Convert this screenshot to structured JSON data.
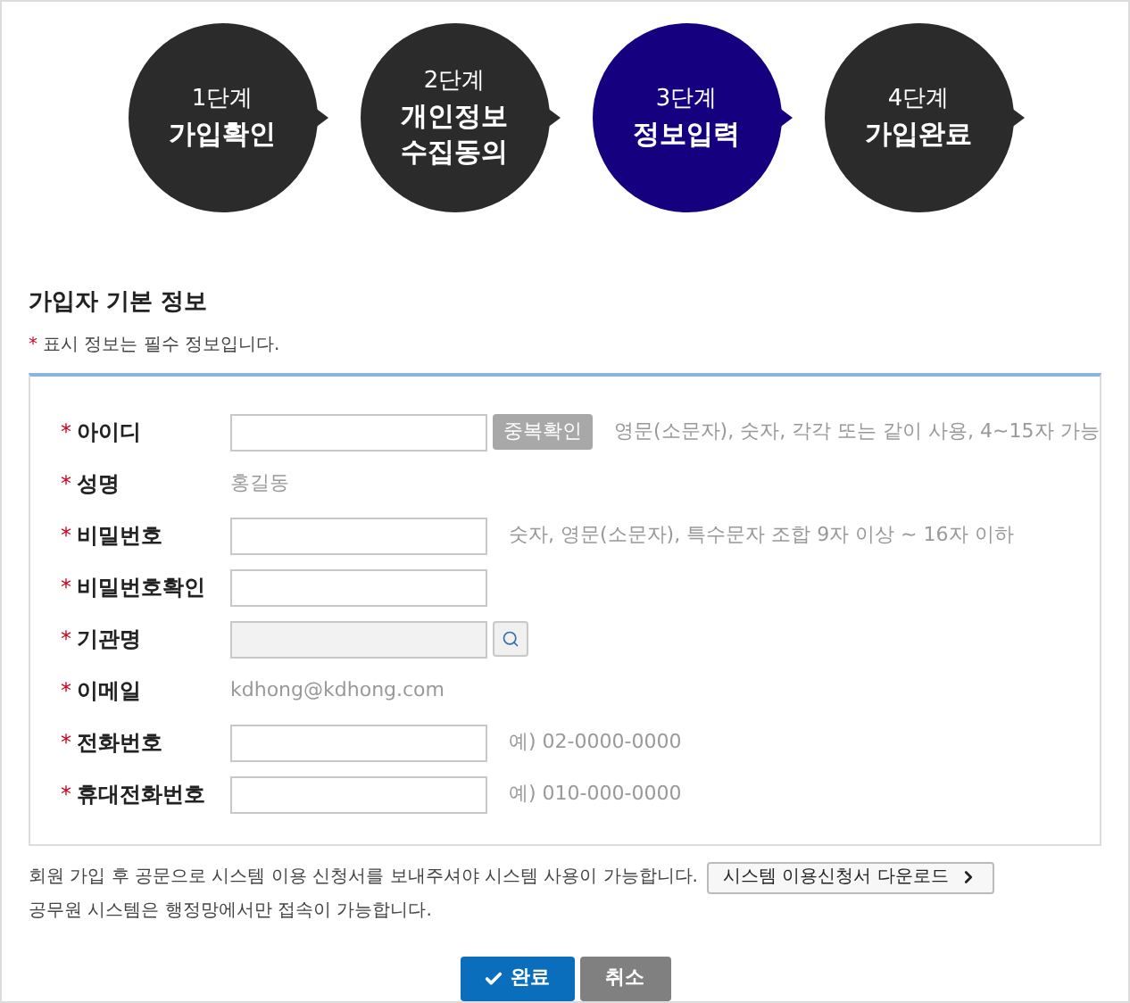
{
  "steps": [
    {
      "step": "1단계",
      "label": "가입확인",
      "selected": false
    },
    {
      "step": "2단계",
      "label": "개인정보 수집동의",
      "selected": false
    },
    {
      "step": "3단계",
      "label": "정보입력",
      "selected": true
    },
    {
      "step": "4단계",
      "label": "가입완료",
      "selected": false
    }
  ],
  "section": {
    "title": "가입자 기본 정보",
    "required_mark": "*",
    "note": "표시 정보는 필수 정보입니다."
  },
  "fields": [
    {
      "kind": "input",
      "required_mark": "*",
      "label": "아이디",
      "button": "중복확인",
      "hint": "영문(소문자), 숫자, 각각 또는 같이 사용, 4~15자 가능"
    },
    {
      "kind": "text",
      "required_mark": "*",
      "label": "성명",
      "value": "홍길동"
    },
    {
      "kind": "input",
      "required_mark": "*",
      "label": "비밀번호",
      "hint": "숫자, 영문(소문자), 특수문자 조합 9자 이상 ~ 16자 이하"
    },
    {
      "kind": "input",
      "required_mark": "*",
      "label": "비밀번호확인"
    },
    {
      "kind": "search",
      "required_mark": "*",
      "label": "기관명",
      "disabled": true
    },
    {
      "kind": "text",
      "required_mark": "*",
      "label": "이메일",
      "value": "kdhong@kdhong.com"
    },
    {
      "kind": "input",
      "required_mark": "*",
      "label": "전화번호",
      "hint": "예) 02-0000-0000"
    },
    {
      "kind": "input",
      "required_mark": "*",
      "label": "휴대전화번호",
      "hint": "예) 010-000-0000"
    }
  ],
  "notice": {
    "line_1": "회원 가입 후 공문으로 시스템 이용 신청서를 보내주셔야 시스템 사용이 가능합니다.",
    "download_button": "시스템 이용신청서 다운로드",
    "line_2": "공무원 시스템은 행정망에서만 접속이 가능합니다."
  },
  "actions": {
    "submit": "완료",
    "cancel": "취소"
  }
}
